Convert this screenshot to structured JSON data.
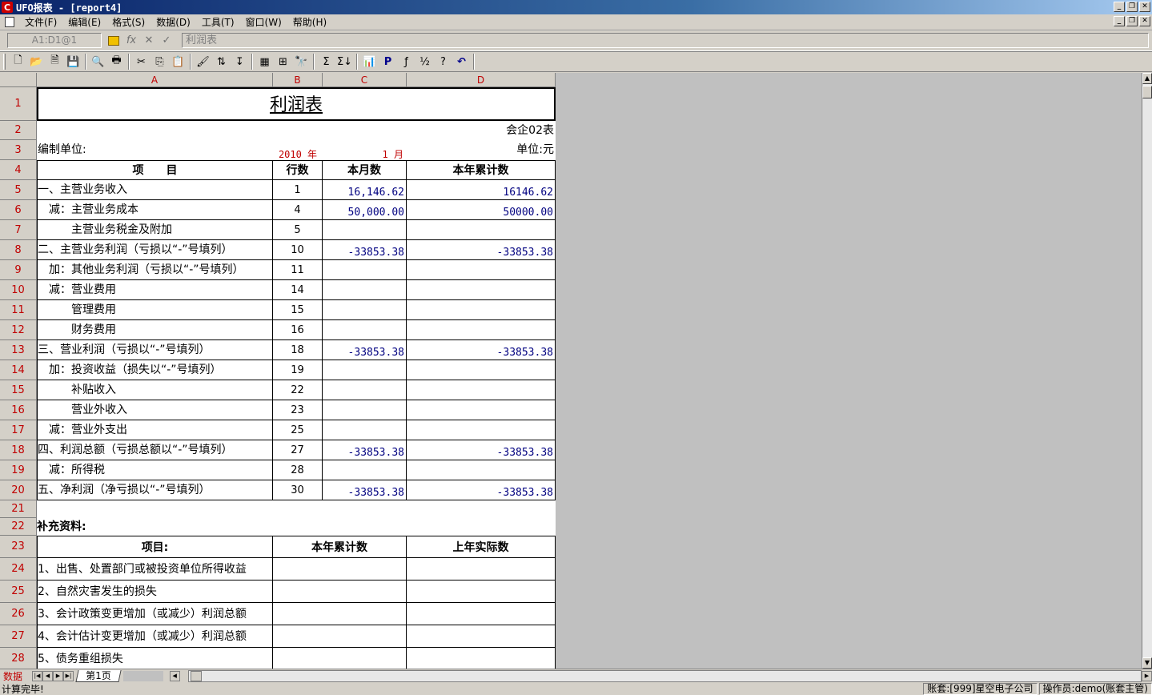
{
  "window": {
    "title": "UFO报表 - [report4]",
    "logo_letter": "C"
  },
  "menu": [
    "文件(F)",
    "编辑(E)",
    "格式(S)",
    "数据(D)",
    "工具(T)",
    "窗口(W)",
    "帮助(H)"
  ],
  "formula_bar": {
    "cell_ref": "A1:D1@1",
    "fx_label": "fx",
    "cancel_glyph": "✕",
    "confirm_glyph": "✓",
    "content": "利润表"
  },
  "toolbar": {
    "new": "🗋",
    "open": "📂",
    "copy_sheet": "🗎",
    "save": "💾",
    "preview": "🔍",
    "print": "🖶",
    "cut": "✂",
    "copy": "⎘",
    "paste": "📋",
    "format_painter": "🖌",
    "sort_asc": "⇅",
    "sort_desc": "↧",
    "merge": "▦",
    "grid": "⊞",
    "find": "🔭",
    "sum": "Σ",
    "sum_all": "Σ↓",
    "chart": "📊",
    "page": "P",
    "insert_func": "ƒ",
    "levels": "½",
    "help": "?",
    "undo": "↶"
  },
  "columns": [
    "A",
    "B",
    "C",
    "D"
  ],
  "rows": [
    "1",
    "2",
    "3",
    "4",
    "5",
    "6",
    "7",
    "8",
    "9",
    "10",
    "11",
    "12",
    "13",
    "14",
    "15",
    "16",
    "17",
    "18",
    "19",
    "20",
    "21",
    "22",
    "23",
    "24",
    "25",
    "26",
    "27",
    "28"
  ],
  "report": {
    "title": "利润表",
    "form_code": "会企02表",
    "company_label": "编制单位:",
    "year": "2010 年",
    "month": "1 月",
    "unit": "单位:元",
    "headers": [
      "项　　目",
      "行数",
      "本月数",
      "本年累计数"
    ],
    "items": [
      {
        "name": "一、主营业务收入",
        "line": "1",
        "month": "16,146.62",
        "year": "16146.62"
      },
      {
        "name": "　减：主营业务成本",
        "line": "4",
        "month": "50,000.00",
        "year": "50000.00"
      },
      {
        "name": "　　　主营业务税金及附加",
        "line": "5",
        "month": "",
        "year": ""
      },
      {
        "name": "二、主营业务利润（亏损以“-”号填列）",
        "line": "10",
        "month": "-33853.38",
        "year": "-33853.38"
      },
      {
        "name": "　加：其他业务利润（亏损以“-”号填列）",
        "line": "11",
        "month": "",
        "year": ""
      },
      {
        "name": "　减：营业费用",
        "line": "14",
        "month": "",
        "year": ""
      },
      {
        "name": "　　　管理费用",
        "line": "15",
        "month": "",
        "year": ""
      },
      {
        "name": "　　　财务费用",
        "line": "16",
        "month": "",
        "year": ""
      },
      {
        "name": "三、营业利润（亏损以“-”号填列）",
        "line": "18",
        "month": "-33853.38",
        "year": "-33853.38"
      },
      {
        "name": "　加：投资收益（损失以“-”号填列）",
        "line": "19",
        "month": "",
        "year": ""
      },
      {
        "name": "　　　补贴收入",
        "line": "22",
        "month": "",
        "year": ""
      },
      {
        "name": "　　　营业外收入",
        "line": "23",
        "month": "",
        "year": ""
      },
      {
        "name": "　减：营业外支出",
        "line": "25",
        "month": "",
        "year": ""
      },
      {
        "name": "四、利润总额（亏损总额以“-”号填列）",
        "line": "27",
        "month": "-33853.38",
        "year": "-33853.38"
      },
      {
        "name": "　减：所得税",
        "line": "28",
        "month": "",
        "year": ""
      },
      {
        "name": "五、净利润（净亏损以“-”号填列）",
        "line": "30",
        "month": "-33853.38",
        "year": "-33853.38"
      }
    ],
    "supplement_title": "补充资料:",
    "supplement_headers": [
      "项目:",
      "本年累计数",
      "上年实际数"
    ],
    "supplement_items": [
      "1、出售、处置部门或被投资单位所得收益",
      "2、自然灾害发生的损失",
      "3、会计政策变更增加（或减少）利润总额",
      "4、会计估计变更增加（或减少）利润总额",
      "5、债务重组损失"
    ]
  },
  "sheet_tabs": {
    "mode": "数据",
    "active_tab": "第1页"
  },
  "status": {
    "message": "计算完毕!",
    "account": "账套:[999]星空电子公司",
    "operator": "操作员:demo(账套主管)"
  }
}
